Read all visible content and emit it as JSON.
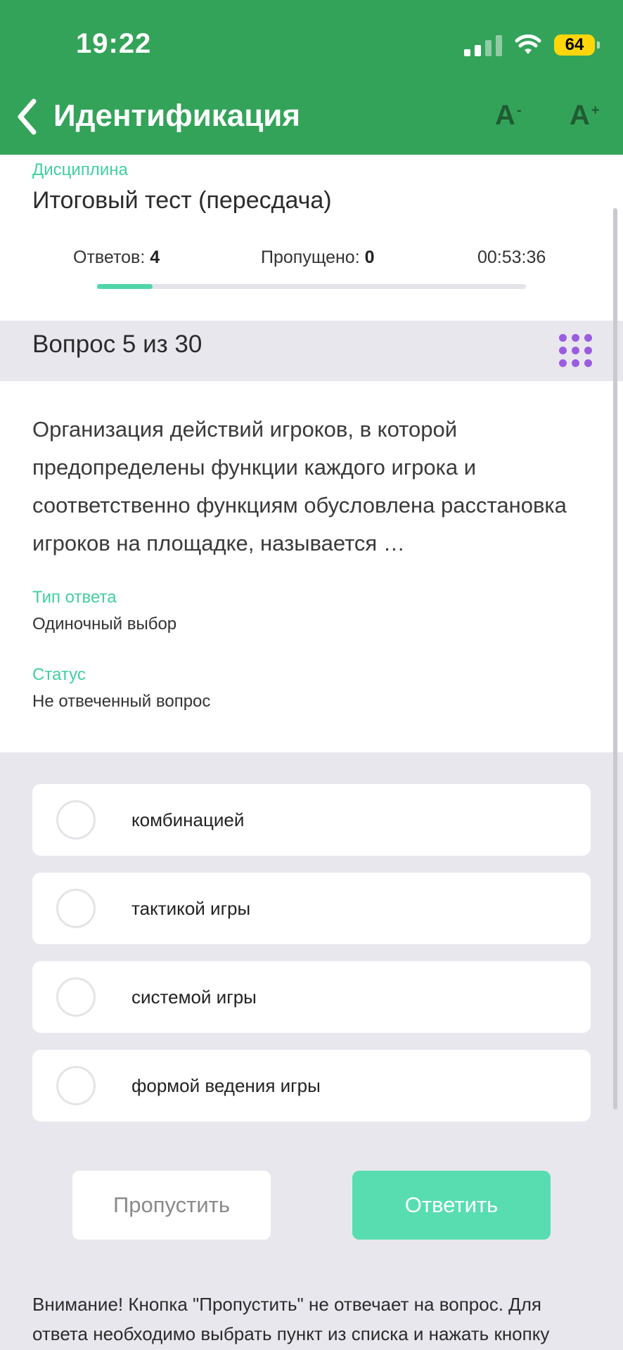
{
  "status_bar": {
    "time": "19:22",
    "battery": "64"
  },
  "nav": {
    "title": "Идентификация"
  },
  "font_controls": {
    "decrease": "A",
    "decrease_sign": "-",
    "increase": "A",
    "increase_sign": "+"
  },
  "discipline": {
    "label": "Дисциплина",
    "title": "Итоговый тест (пересдача)"
  },
  "stats": {
    "answered_label": "Ответов:",
    "answered_value": "4",
    "skipped_label": "Пропущено:",
    "skipped_value": "0",
    "timer": "00:53:36",
    "progress": 0.13,
    "accent": "#4fd6a8"
  },
  "question": {
    "counter": "Вопрос 5 из 30",
    "text": "Организация действий игроков, в которой предопределены функции каждого игрока и соответственно функциям обусловлена расстановка игроков на площадке, называется …",
    "type_label": "Тип ответа",
    "type_value": "Одиночный выбор",
    "status_label": "Статус",
    "status_value": "Не отвеченный вопрос"
  },
  "options": [
    {
      "label": "комбинацией"
    },
    {
      "label": "тактикой игры"
    },
    {
      "label": "системой игры"
    },
    {
      "label": "формой ведения игры"
    }
  ],
  "actions": {
    "skip": "Пропустить",
    "answer": "Ответить"
  },
  "warning": "Внимание! Кнопка \"Пропустить\" не отвечает на вопрос. Для ответа необходимо выбрать пункт из списка и нажать кнопку",
  "colors": {
    "header": "#34A35A",
    "accent": "#41CFA0",
    "answer_button": "#57DDB0",
    "grid_icon": "#9B5DE0"
  }
}
